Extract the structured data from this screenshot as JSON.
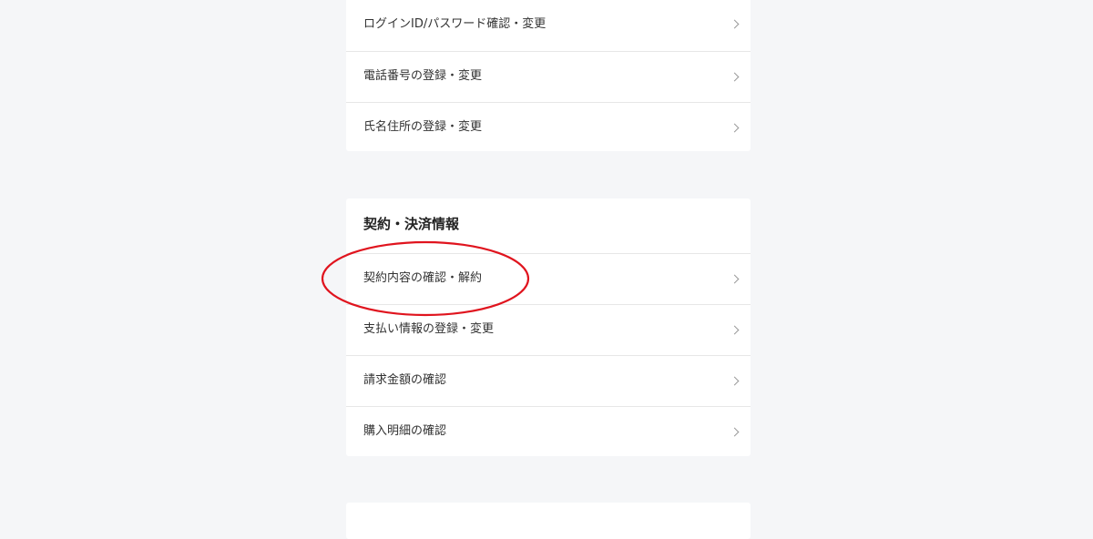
{
  "account_card": {
    "items": [
      {
        "label": "ログインID/パスワード確認・変更"
      },
      {
        "label": "電話番号の登録・変更"
      },
      {
        "label": "氏名住所の登録・変更"
      }
    ]
  },
  "contract_card": {
    "title": "契約・決済情報",
    "items": [
      {
        "label": "契約内容の確認・解約"
      },
      {
        "label": "支払い情報の登録・変更"
      },
      {
        "label": "請求金額の確認"
      },
      {
        "label": "購入明細の確認"
      }
    ]
  },
  "annotation": {
    "color": "#e0141e",
    "target": "契約内容の確認・解約"
  },
  "icons": {
    "row_chevron": "chevron-right-icon"
  }
}
